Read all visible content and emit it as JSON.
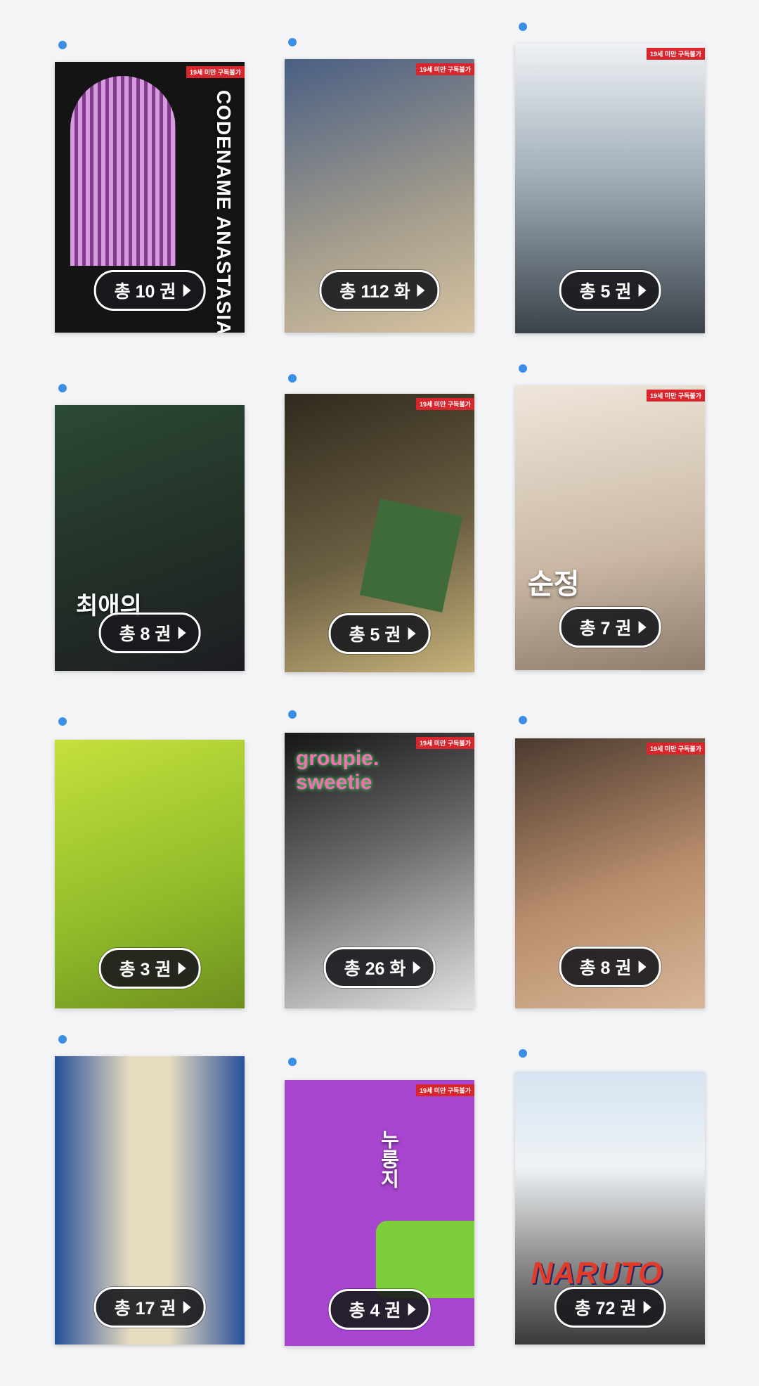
{
  "books": [
    {
      "count": "총 10 권",
      "age_tag": "19세 미만 구독불가",
      "title": "CODENAME ANASTASIA",
      "colors": {
        "a": "#141414",
        "b": "#2a1a2e"
      }
    },
    {
      "count": "총 112 화",
      "age_tag": "19세 미만 구독불가",
      "title": "",
      "colors": {
        "a": "#6a7ea0",
        "b": "#c8b79d"
      }
    },
    {
      "count": "총 5 권",
      "age_tag": "19세 미만 구독불가",
      "title": "",
      "colors": {
        "a": "#dfe7ee",
        "b": "#8f9ba6"
      }
    },
    {
      "count": "총 8 권",
      "age_tag": "",
      "title": "최애의",
      "colors": {
        "a": "#35503a",
        "b": "#23282c"
      }
    },
    {
      "count": "총 5 권",
      "age_tag": "19세 미만 구독불가",
      "title": "",
      "colors": {
        "a": "#3d3523",
        "b": "#7a6d4d"
      }
    },
    {
      "count": "총 7 권",
      "age_tag": "19세 미만 구독불가",
      "title": "순정",
      "colors": {
        "a": "#e7ddd1",
        "b": "#b9a591"
      }
    },
    {
      "count": "총 3 권",
      "age_tag": "",
      "title": "",
      "colors": {
        "a": "#b5d335",
        "b": "#7ba124"
      }
    },
    {
      "count": "총 26 화",
      "age_tag": "19세 미만 구독불가",
      "title": "groupie. sweetie",
      "colors": {
        "a": "#1c1c1c",
        "b": "#d9dcd9"
      }
    },
    {
      "count": "총 8 권",
      "age_tag": "19세 미만 구독불가",
      "title": "",
      "colors": {
        "a": "#c9a483",
        "b": "#5f6d4d"
      }
    },
    {
      "count": "총 17 권",
      "age_tag": "",
      "title": "",
      "colors": {
        "a": "#eadfc4",
        "b": "#264f9a"
      }
    },
    {
      "count": "총 4 권",
      "age_tag": "19세 미만 구독불가",
      "title": "누룽지",
      "colors": {
        "a": "#9b3fc4",
        "b": "#b04ad4"
      }
    },
    {
      "count": "총 72 권",
      "age_tag": "",
      "title": "NARUTO",
      "colors": {
        "a": "#e9eef4",
        "b": "#c2422f"
      }
    }
  ]
}
